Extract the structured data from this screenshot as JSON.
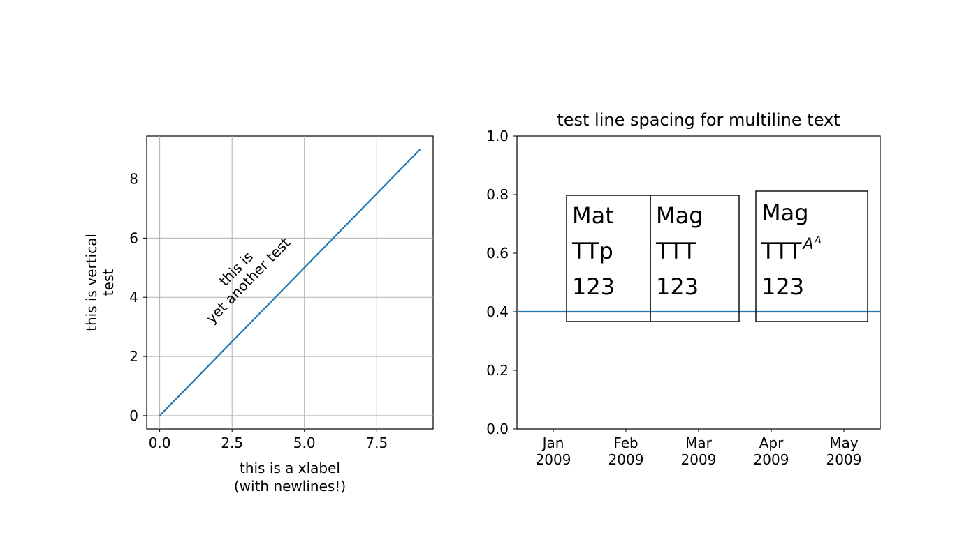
{
  "chart_data": [
    {
      "type": "line",
      "x": [
        0,
        1,
        2,
        3,
        4,
        5,
        6,
        7,
        8,
        9
      ],
      "y": [
        0,
        1,
        2,
        3,
        4,
        5,
        6,
        7,
        8,
        9
      ],
      "xlim": [
        -0.45,
        9.45
      ],
      "ylim": [
        -0.45,
        9.45
      ],
      "xticks": [
        0.0,
        2.5,
        5.0,
        7.5
      ],
      "yticks": [
        0,
        2,
        4,
        6,
        8
      ],
      "xlabel_line1": "this is a xlabel",
      "xlabel_line2": "(with newlines!)",
      "ylabel_line1": "this is vertical",
      "ylabel_line2": "test",
      "annotation_line1": "this is",
      "annotation_line2": "yet another test",
      "grid": true,
      "line_color": "#1f77b4"
    },
    {
      "type": "line",
      "title": "test line spacing for multiline text",
      "hline_y": 0.4,
      "ylim": [
        0.0,
        1.0
      ],
      "yticks": [
        0.0,
        0.2,
        0.4,
        0.6,
        0.8,
        1.0
      ],
      "xticks": [
        "Jan\n2009",
        "Feb\n2009",
        "Mar\n2009",
        "Apr\n2009",
        "May\n2009"
      ],
      "boxes": [
        {
          "x": 0.29,
          "line1": "Mat",
          "line2": "TTp",
          "line3": "123",
          "superscript": ""
        },
        {
          "x": 0.5,
          "line1": "Mag",
          "line2": "TTT",
          "line3": "123",
          "superscript": ""
        },
        {
          "x": 0.762,
          "line1": "Mag",
          "line2": "TTT",
          "line3": "123",
          "superscript": "A",
          "superscript2": "A"
        }
      ],
      "line_color": "#1f77b4"
    }
  ],
  "left": {
    "xticks": {
      "t0": "0.0",
      "t1": "2.5",
      "t2": "5.0",
      "t3": "7.5"
    },
    "yticks": {
      "t0": "0",
      "t1": "2",
      "t2": "4",
      "t3": "6",
      "t4": "8"
    },
    "xlabel1": "this is a xlabel",
    "xlabel2": "(with newlines!)",
    "ylabel1": "this is vertical",
    "ylabel2": "test",
    "ann1": "this is",
    "ann2": "yet another test"
  },
  "right": {
    "title": "test line spacing for multiline text",
    "yticks": {
      "t0": "0.0",
      "t1": "0.2",
      "t2": "0.4",
      "t3": "0.6",
      "t4": "0.8",
      "t5": "1.0"
    },
    "xticks": {
      "m1a": "Jan",
      "m1b": "2009",
      "m2a": "Feb",
      "m2b": "2009",
      "m3a": "Mar",
      "m3b": "2009",
      "m4a": "Apr",
      "m4b": "2009",
      "m5a": "May",
      "m5b": "2009"
    },
    "box1": {
      "l1": "Mat",
      "l2": "TTp",
      "l3": "123"
    },
    "box2": {
      "l1": "Mag",
      "l2": "TTT",
      "l3": "123"
    },
    "box3": {
      "l1": "Mag",
      "l2": "TTT",
      "l3": "123",
      "sup": "A",
      "sup2": "A"
    }
  }
}
